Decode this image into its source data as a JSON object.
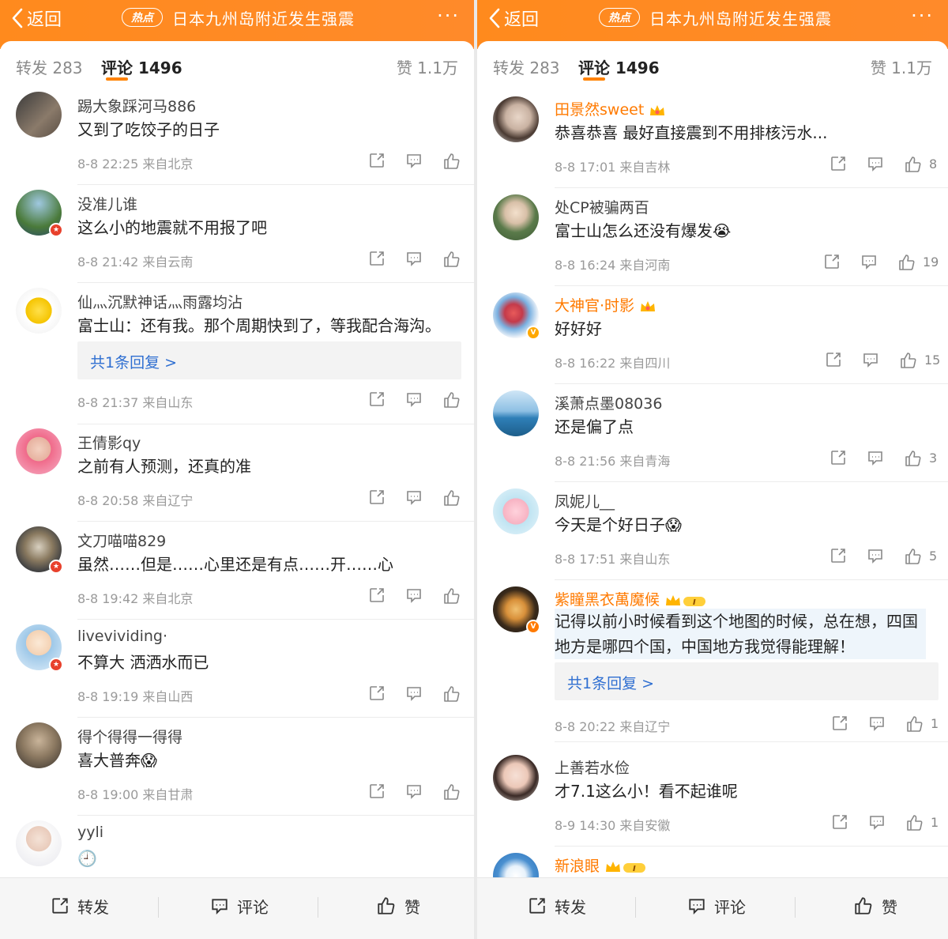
{
  "header": {
    "back_label": "返回",
    "hot_badge": "热点",
    "topic_title": "日本九州岛附近发生强震",
    "more_label": "···"
  },
  "tabs": {
    "repost": "转发 283",
    "comment": "评论 1496",
    "likes": "赞 1.1万"
  },
  "colors": {
    "brand": "#ff8a1d",
    "accent": "#ff8200",
    "link": "#2f6fd1"
  },
  "left_comments": [
    {
      "user": "踢大象踩河马886",
      "text": "又到了吃饺子的日子",
      "meta": "8-8 22:25  来自北京",
      "like_count": ""
    },
    {
      "user": "没准儿谁",
      "text": "这么小的地震就不用报了吧",
      "meta": "8-8 21:42  来自云南",
      "like_count": ""
    },
    {
      "user": "仙灬沉默神话灬雨露均沾",
      "text": "富士山：还有我。那个周期快到了，等我配合海沟。",
      "meta": "8-8 21:37  来自山东",
      "like_count": "",
      "reply": "共1条回复 >"
    },
    {
      "user": "王倩影qy",
      "text": "之前有人预测，还真的准",
      "meta": "8-8 20:58  来自辽宁",
      "like_count": ""
    },
    {
      "user": "文刀喵喵829",
      "text": "虽然……但是……心里还是有点……开……心",
      "meta": "8-8 19:42  来自北京",
      "like_count": ""
    },
    {
      "user": "livevividing·",
      "text": "不算大 洒洒水而已",
      "meta": "8-8 19:19  来自山西",
      "like_count": ""
    },
    {
      "user": "得个得得一得得",
      "text": "喜大普奔😱",
      "meta": "8-8 19:00  来自甘肃",
      "like_count": ""
    },
    {
      "user": "yyli",
      "text": "🕘",
      "meta": "",
      "like_count": ""
    }
  ],
  "right_comments": [
    {
      "user": "田景然sweet",
      "text": "恭喜恭喜 最好直接震到不用排核污水...",
      "meta": "8-8 17:01  来自吉林",
      "like_count": "8"
    },
    {
      "user": "处CP被骗两百",
      "text": "富士山怎么还没有爆发😭",
      "meta": "8-8 16:24  来自河南",
      "like_count": "19"
    },
    {
      "user": "大神官·时影",
      "text": "好好好",
      "meta": "8-8 16:22  来自四川",
      "like_count": "15"
    },
    {
      "user": "溪萧点墨08036",
      "text": "还是偏了点",
      "meta": "8-8 21:56  来自青海",
      "like_count": "3"
    },
    {
      "user": "凤妮儿__",
      "text": "今天是个好日子😱",
      "meta": "8-8 17:51  来自山东",
      "like_count": "5"
    },
    {
      "user": "紫瞳黑衣萬魔候",
      "text": "记得以前小时候看到这个地图的时候，总在想，四国地方是哪四个国，中国地方我觉得能理解！",
      "meta": "8-8 20:22  来自辽宁",
      "like_count": "1",
      "reply": "共1条回复 >"
    },
    {
      "user": "上善若水俭",
      "text": "才7.1这么小！看不起谁呢",
      "meta": "8-9 14:30  来自安徽",
      "like_count": "1"
    },
    {
      "user": "新浪眼",
      "text": "",
      "meta": "",
      "like_count": ""
    }
  ],
  "bottom_bar": {
    "repost": "转发",
    "comment": "评论",
    "like": "赞"
  }
}
